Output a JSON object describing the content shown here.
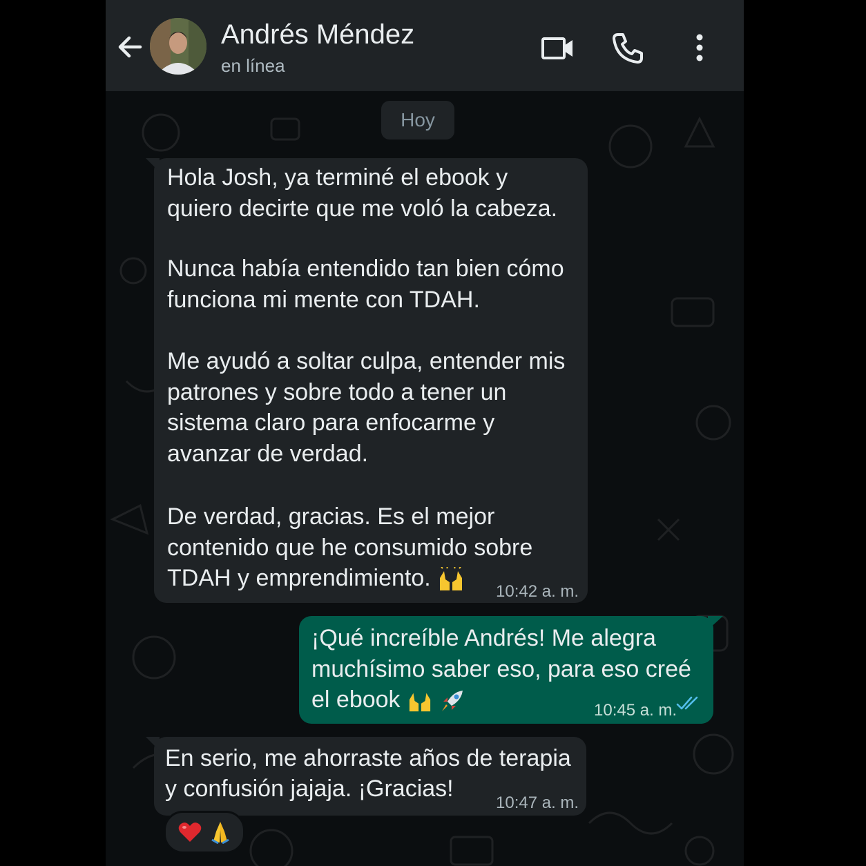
{
  "header": {
    "contact_name": "Andrés Méndez",
    "status": "en línea",
    "icons": [
      "back-arrow-icon",
      "video-call-icon",
      "phone-call-icon",
      "more-options-icon"
    ]
  },
  "chat": {
    "date_label": "Hoy",
    "messages": [
      {
        "direction": "incoming",
        "paragraphs": [
          "Hola Josh, ya terminé el ebook y\nquiero decirte que me voló la cabeza.",
          "Nunca había entendido tan bien cómo\nfunciona mi mente con TDAH.",
          "Me ayudó a soltar culpa, entender mis\npatrones y sobre todo a tener un\nsistema claro para enfocarme y\navanzar de verdad.",
          "De verdad, gracias. Es el mejor\ncontenido que he consumido sobre",
          "TDAH y emprendimiento."
        ],
        "emoji": [
          "raising-hands-emoji"
        ],
        "time": "10:42 a. m."
      },
      {
        "direction": "outgoing",
        "paragraphs": [
          "¡Qué increíble Andrés! Me alegra\nmuchísimo saber eso, para eso creé",
          "el ebook"
        ],
        "emoji": [
          "raising-hands-emoji",
          "rocket-emoji"
        ],
        "time": "10:45 a. m.",
        "read_receipt": "double-check-icon"
      },
      {
        "direction": "incoming",
        "paragraphs": [
          "En serio, me ahorraste años de terapia",
          "y confusión jajaja. ¡Gracias!"
        ],
        "time": "10:47 a. m.",
        "reactions": [
          "red-heart-emoji",
          "folded-hands-emoji"
        ]
      }
    ]
  },
  "colors": {
    "header_bg": "#1f2326",
    "chat_bg": "#0b0e10",
    "incoming_bubble": "#1f2326",
    "outgoing_bubble": "#005c4b",
    "read_check": "#53bdeb"
  }
}
